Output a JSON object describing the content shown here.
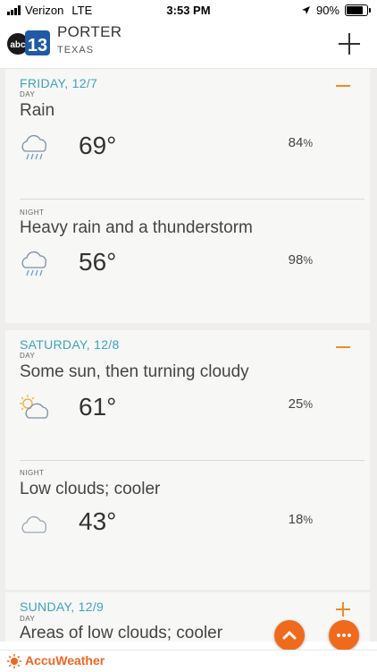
{
  "status": {
    "carrier": "Verizon",
    "network": "LTE",
    "time": "3:53 PM",
    "battery": "90%",
    "battery_fraction": 0.9
  },
  "header": {
    "logo_text": "abc",
    "logo_num": "13",
    "city": "PORTER",
    "state": "TEXAS"
  },
  "days": [
    {
      "date": "FRIDAY, 12/7",
      "toggle": "collapse",
      "periods": [
        {
          "label": "DAY",
          "phrase": "Rain",
          "icon": "rain-cloud-icon",
          "temp": "69°",
          "precip_value": "84",
          "precip_unit": "%"
        },
        {
          "label": "NIGHT",
          "phrase": "Heavy rain and a thunderstorm",
          "icon": "rain-cloud-icon",
          "temp": "56°",
          "precip_value": "98",
          "precip_unit": "%"
        }
      ]
    },
    {
      "date": "SATURDAY, 12/8",
      "toggle": "collapse",
      "periods": [
        {
          "label": "DAY",
          "phrase": "Some sun, then turning cloudy",
          "icon": "partly-sunny-icon",
          "temp": "61°",
          "precip_value": "25",
          "precip_unit": "%"
        },
        {
          "label": "NIGHT",
          "phrase": "Low clouds; cooler",
          "icon": "cloud-icon",
          "temp": "43°",
          "precip_value": "18",
          "precip_unit": "%"
        }
      ]
    },
    {
      "date": "SUNDAY, 12/9",
      "toggle": "expand",
      "periods": [
        {
          "label": "DAY",
          "phrase": "Areas of low clouds; cooler"
        }
      ]
    }
  ],
  "footer": {
    "brand": "AccuWeather"
  },
  "colors": {
    "accent_blue": "#3da3be",
    "accent_orange": "#f08a24",
    "fab_orange": "#f06a1d"
  }
}
